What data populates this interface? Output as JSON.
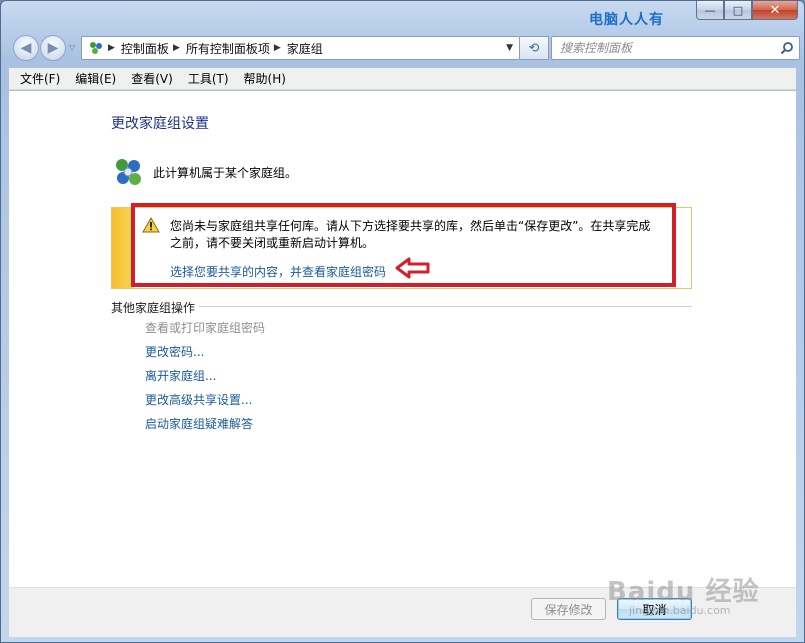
{
  "window": {
    "watermark_title": "电脑人人有"
  },
  "caption": {
    "minimize": "—",
    "maximize": "□",
    "close": "✕"
  },
  "nav": {
    "back": "◀",
    "forward": "▶",
    "dropdown": "▽"
  },
  "address": {
    "crumbs": [
      "控制面板",
      "所有控制面板项",
      "家庭组"
    ],
    "separator": "▶",
    "dropdown": "▼"
  },
  "refresh": "⟲",
  "search": {
    "placeholder": "搜索控制面板"
  },
  "menu": [
    "文件(F)",
    "编辑(E)",
    "查看(V)",
    "工具(T)",
    "帮助(H)"
  ],
  "main": {
    "title": "更改家庭组设置",
    "status": "此计算机属于某个家庭组。",
    "notice": {
      "text": "您尚未与家庭组共享任何库。请从下方选择要共享的库，然后单击“保存更改”。在共享完成之前，请不要关闭或重新启动计算机。",
      "link": "选择您要共享的内容，并查看家庭组密码"
    },
    "section_title": "其他家庭组操作",
    "actions": [
      {
        "label": "查看或打印家庭组密码",
        "enabled": false
      },
      {
        "label": "更改密码...",
        "enabled": true
      },
      {
        "label": "离开家庭组...",
        "enabled": true
      },
      {
        "label": "更改高级共享设置...",
        "enabled": true
      },
      {
        "label": "启动家庭组疑难解答",
        "enabled": true
      }
    ]
  },
  "footer": {
    "save_label": "保存修改",
    "cancel_label": "取消"
  },
  "watermark": {
    "brand": "Baidu 经验",
    "url": "jingyan.baidu.com"
  },
  "colors": {
    "link": "#1a5b9a",
    "highlight": "#d0202a",
    "warning_stripe": "#f4c12c",
    "title": "#1e3287"
  }
}
